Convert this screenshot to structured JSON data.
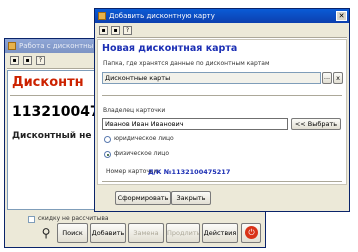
{
  "back_window": {
    "title": "Работа с дисконтны",
    "heading": "Дисконтн",
    "card_number": "113210047",
    "status": "Дисконтный не н",
    "checkbox_label": "скидку не рассчитыва",
    "buttons": {
      "search": "Поиск",
      "add": "Добавить",
      "replace": "Замена",
      "extend": "Продлить",
      "actions": "Действия"
    }
  },
  "dialog": {
    "title": "Добавить дисконтную карту",
    "heading": "Новая дисконтная карта",
    "folder_label": "Папка, где хранятся данные по дисконтным картам",
    "folder_value": "Дисконтные карты",
    "browse_btn": "...",
    "clear_btn": "x",
    "owner_label": "Владелец карточки",
    "owner_value": "Иванов Иван Иванович",
    "choose_btn": "<< Выбрать",
    "radio_legal": "юридическое лицо",
    "radio_physical": "физическое лицо",
    "card_number_label": "Номер карточки:",
    "card_number_value": "Д/К №1132100475217",
    "generate_btn": "Сформировать",
    "close_btn": "Закрыть"
  },
  "colors": {
    "titlebar": "#0a5bd6",
    "heading_red": "#cc2200",
    "heading_blue": "#1c2fb4"
  }
}
